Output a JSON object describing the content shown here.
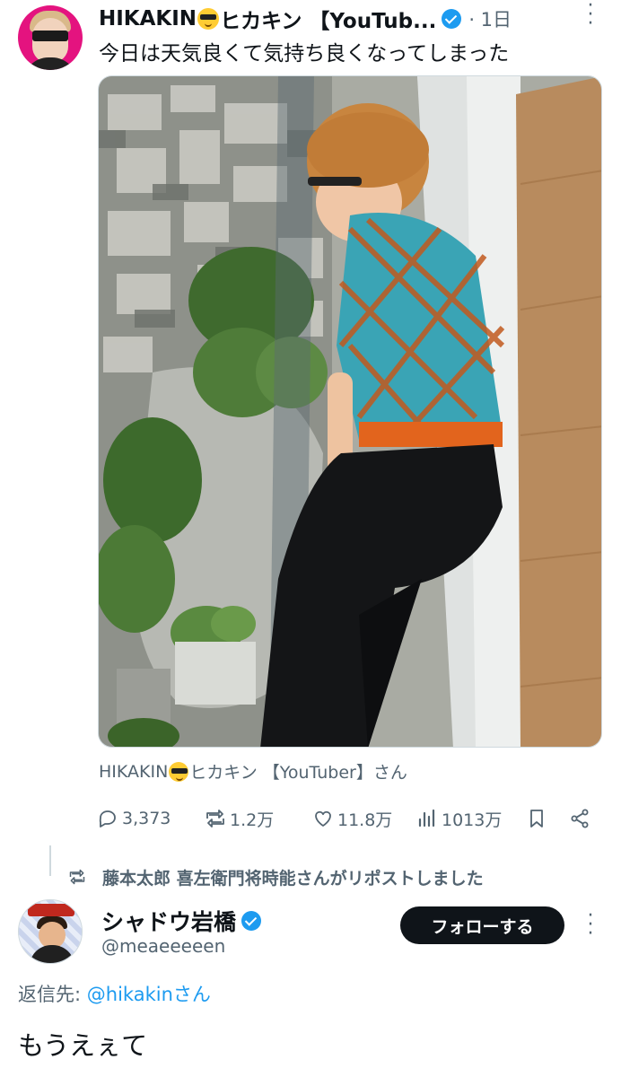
{
  "tweet": {
    "author_name": "HIKAKIN",
    "author_name_suffix": "ヒカキン 【YouTub...",
    "time": "· 1日",
    "text": "今日は天気良くて気持ち良くなってしまった",
    "photo_caption_name": "HIKAKIN",
    "photo_caption_suffix": "ヒカキン 【YouTuber】さん",
    "stats": {
      "replies": "3,373",
      "reposts": "1.2万",
      "likes": "11.8万",
      "views": "1013万"
    }
  },
  "reply": {
    "repost_context": "藤本太郎 喜左衛門将時能さんがリポストしました",
    "author_name": "シャドウ岩橋",
    "handle": "@meaeeeeen",
    "follow_label": "フォローする",
    "reply_to_label": "返信先:",
    "reply_to_link": "@hikakinさん",
    "text": "もうえぇて"
  },
  "colors": {
    "text": "#0f1419",
    "secondary": "#536471",
    "link": "#1d9bf0",
    "verified": "#1d9bf0",
    "follow_bg": "#0f1419"
  },
  "icons": [
    "more-icon",
    "verified-icon",
    "reply-icon",
    "repost-icon",
    "like-icon",
    "views-icon",
    "bookmark-icon",
    "share-icon",
    "repost-context-icon"
  ]
}
